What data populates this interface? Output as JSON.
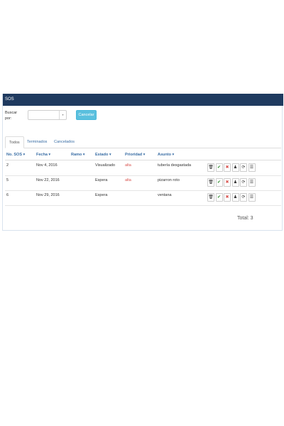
{
  "panel": {
    "title": "SOS"
  },
  "search": {
    "label": "Buscar por:",
    "select_value": "",
    "cancel_label": "Cancelar"
  },
  "tabs": [
    {
      "label": "Todos",
      "active": true
    },
    {
      "label": "Terminados",
      "active": false
    },
    {
      "label": "Cancelados",
      "active": false
    }
  ],
  "columns": [
    "No. SOS",
    "Fecha",
    "Ramo",
    "Estado",
    "Prioridad",
    "Asunto"
  ],
  "rows": [
    {
      "no": "2",
      "fecha": "Nov 4, 2016",
      "ramo": "",
      "estado": "Visualizado",
      "prioridad": "alta",
      "asunto": "tubería desgastada"
    },
    {
      "no": "5",
      "fecha": "Nov 22, 2016",
      "ramo": "",
      "estado": "Espera",
      "prioridad": "alta",
      "asunto": "pizarron roto"
    },
    {
      "no": "6",
      "fecha": "Nov 29, 2016",
      "ramo": "",
      "estado": "Espera",
      "prioridad": "",
      "asunto": "ventana"
    }
  ],
  "action_icons": [
    "trash-icon",
    "check-icon",
    "x-icon",
    "user-icon",
    "refresh-icon",
    "list-icon"
  ],
  "colors": {
    "header": "#1f3a5f",
    "accent": "#3a6ea5",
    "cancel": "#5bc0de",
    "check": "#2e8b2e",
    "x": "#d9534f",
    "priority": "#d9534f"
  },
  "total": "Total: 3"
}
